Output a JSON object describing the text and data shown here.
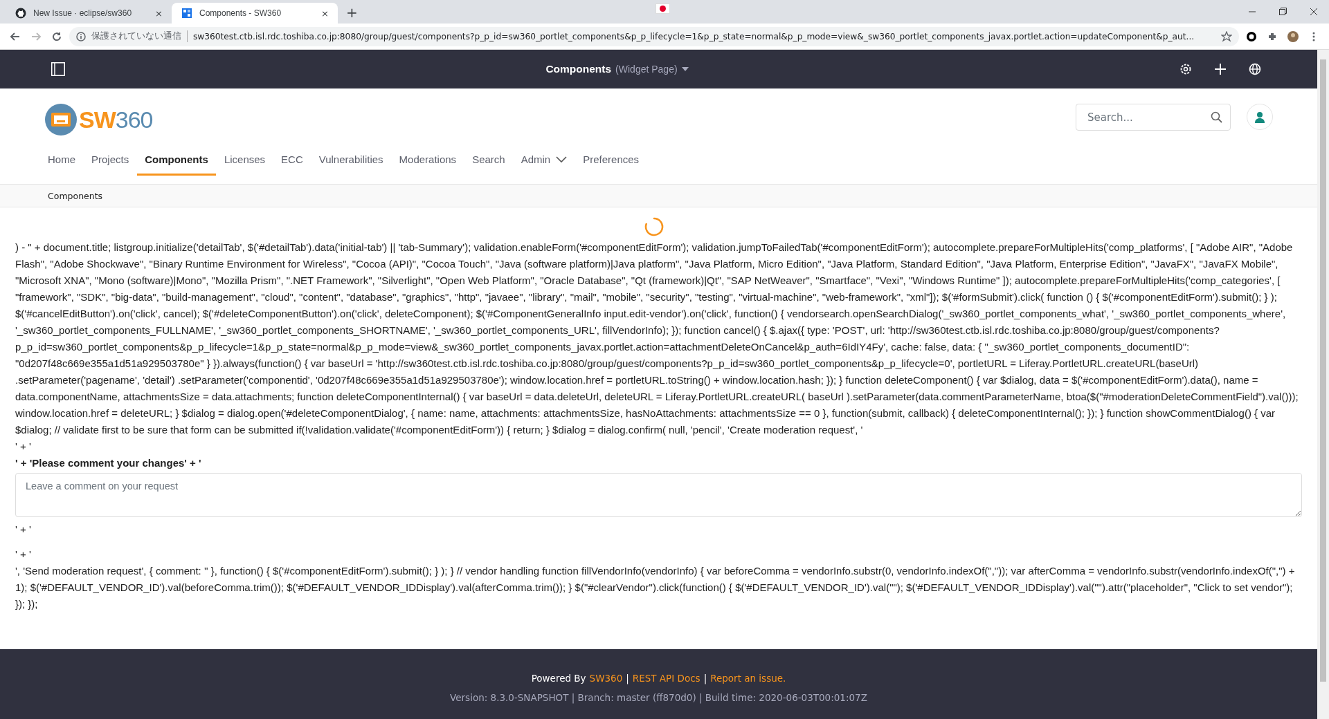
{
  "browser": {
    "tabs": [
      {
        "title": "New Issue · eclipse/sw360",
        "selected": false
      },
      {
        "title": "Components - SW360",
        "selected": true
      }
    ],
    "tab_close": "×",
    "new_tab": "+",
    "security_label": "保護されていない通信",
    "url": "sw360test.ctb.isl.rdc.toshiba.co.jp:8080/group/guest/components?p_p_id=sw360_portlet_components&p_p_lifecycle=1&p_p_state=normal&p_p_mode=view&_sw360_portlet_components_javax.portlet.action=updateComponent&p_aut..."
  },
  "control_bar": {
    "title": "Components",
    "subtitle": "(Widget Page)"
  },
  "header": {
    "logo": {
      "prefix": "SW",
      "suffix": "360"
    },
    "search": {
      "placeholder": "Search..."
    },
    "nav": [
      {
        "label": "Home",
        "selected": false,
        "dropdown": false
      },
      {
        "label": "Projects",
        "selected": false,
        "dropdown": false
      },
      {
        "label": "Components",
        "selected": true,
        "dropdown": false
      },
      {
        "label": "Licenses",
        "selected": false,
        "dropdown": false
      },
      {
        "label": "ECC",
        "selected": false,
        "dropdown": false
      },
      {
        "label": "Vulnerabilities",
        "selected": false,
        "dropdown": false
      },
      {
        "label": "Moderations",
        "selected": false,
        "dropdown": false
      },
      {
        "label": "Search",
        "selected": false,
        "dropdown": false
      },
      {
        "label": "Admin",
        "selected": false,
        "dropdown": true
      },
      {
        "label": "Preferences",
        "selected": false,
        "dropdown": false
      }
    ]
  },
  "breadcrumb": [
    "Components"
  ],
  "content": [
    {
      "kind": "code",
      "text": ") - \" + document.title; listgroup.initialize('detailTab', $('#detailTab').data('initial-tab') || 'tab-Summary'); validation.enableForm('#componentEditForm'); validation.jumpToFailedTab('#componentEditForm'); autocomplete.prepareForMultipleHits('comp_platforms', [ \"Adobe AIR\", \"Adobe Flash\", \"Adobe Shockwave\", \"Binary Runtime Environment for Wireless\", \"Cocoa (API)\", \"Cocoa Touch\", \"Java (software platform)|Java platform\", \"Java Platform, Micro Edition\", \"Java Platform, Standard Edition\", \"Java Platform, Enterprise Edition\", \"JavaFX\", \"JavaFX Mobile\", \"Microsoft XNA\", \"Mono (software)|Mono\", \"Mozilla Prism\", \".NET Framework\", \"Silverlight\", \"Open Web Platform\", \"Oracle Database\", \"Qt (framework)|Qt\", \"SAP NetWeaver\", \"Smartface\", \"Vexi\", \"Windows Runtime\" ]); autocomplete.prepareForMultipleHits('comp_categories', [ \"framework\", \"SDK\", \"big-data\", \"build-management\", \"cloud\", \"content\", \"database\", \"graphics\", \"http\", \"javaee\", \"library\", \"mail\", \"mobile\", \"security\", \"testing\", \"virtual-machine\", \"web-framework\", \"xml\"]); $('#formSubmit').click( function () { $('#componentEditForm').submit(); } ); $('#cancelEditButton').on('click', cancel); $('#deleteComponentButton').on('click', deleteComponent); $('#ComponentGeneralInfo input.edit-vendor').on('click', function() { vendorsearch.openSearchDialog('_sw360_portlet_components_what', '_sw360_portlet_components_where', '_sw360_portlet_components_FULLNAME', '_sw360_portlet_components_SHORTNAME', '_sw360_portlet_components_URL', fillVendorInfo); }); function cancel() { $.ajax({ type: 'POST', url: 'http://sw360test.ctb.isl.rdc.toshiba.co.jp:8080/group/guest/components?p_p_id=sw360_portlet_components&p_p_lifecycle=1&p_p_state=normal&p_p_mode=view&_sw360_portlet_components_javax.portlet.action=attachmentDeleteOnCancel&p_auth=6IdIY4Fy', cache: false, data: { \"_sw360_portlet_components_documentID\": \"0d207f48c669e355a1d51a929503780e\" } }).always(function() { var baseUrl = 'http://sw360test.ctb.isl.rdc.toshiba.co.jp:8080/group/guest/components?p_p_id=sw360_portlet_components&p_p_lifecycle=0', portletURL = Liferay.PortletURL.createURL(baseUrl) .setParameter('pagename', 'detail') .setParameter('componentid', '0d207f48c669e355a1d51a929503780e'); window.location.href = portletURL.toString() + window.location.hash; }); } function deleteComponent() { var $dialog, data = $('#componentEditForm').data(), name = data.componentName, attachmentsSize = data.attachments; function deleteComponentInternal() { var baseUrl = data.deleteUrl, deleteURL = Liferay.PortletURL.createURL( baseUrl ).setParameter(data.commentParameterName, btoa($(\"#moderationDeleteCommentField\").val())); window.location.href = deleteURL; } $dialog = dialog.open('#deleteComponentDialog', { name: name, attachments: attachmentsSize, hasNoAttachments: attachmentsSize == 0 }, function(submit, callback) { deleteComponentInternal(); }); } function showCommentDialog() { var $dialog; // validate first to be sure that form can be submitted if(!validation.validate('#componentEditForm')) { return; } $dialog = dialog.confirm( null, 'pencil', 'Create moderation request', '"
    },
    {
      "kind": "code",
      "text": "' + '"
    },
    {
      "kind": "label",
      "text": "' + 'Please comment your changes' + '"
    },
    {
      "kind": "textarea",
      "placeholder": "Leave a comment on your request"
    },
    {
      "kind": "code",
      "text": "' + '"
    },
    {
      "kind": "code",
      "text": "' + '"
    },
    {
      "kind": "code",
      "text": "', 'Send moderation request', { comment: '' }, function() { $('#componentEditForm').submit(); } ); } // vendor handling function fillVendorInfo(vendorInfo) { var beforeComma = vendorInfo.substr(0, vendorInfo.indexOf(\",\")); var afterComma = vendorInfo.substr(vendorInfo.indexOf(\",\") + 1); $('#DEFAULT_VENDOR_ID').val(beforeComma.trim()); $('#DEFAULT_VENDOR_IDDisplay').val(afterComma.trim()); } $(\"#clearVendor\").click(function() { $('#DEFAULT_VENDOR_ID').val(\"\"); $('#DEFAULT_VENDOR_IDDisplay').val(\"\").attr(\"placeholder\", \"Click to set vendor\"); }); });"
    }
  ],
  "footer": {
    "powered_by": "Powered By",
    "links": [
      "SW360",
      "REST API Docs",
      "Report an issue."
    ],
    "separator": "|",
    "version": "Version: 8.3.0-SNAPSHOT | Branch: master (ff870d0) | Build time: 2020-06-03T00:01:07Z"
  }
}
